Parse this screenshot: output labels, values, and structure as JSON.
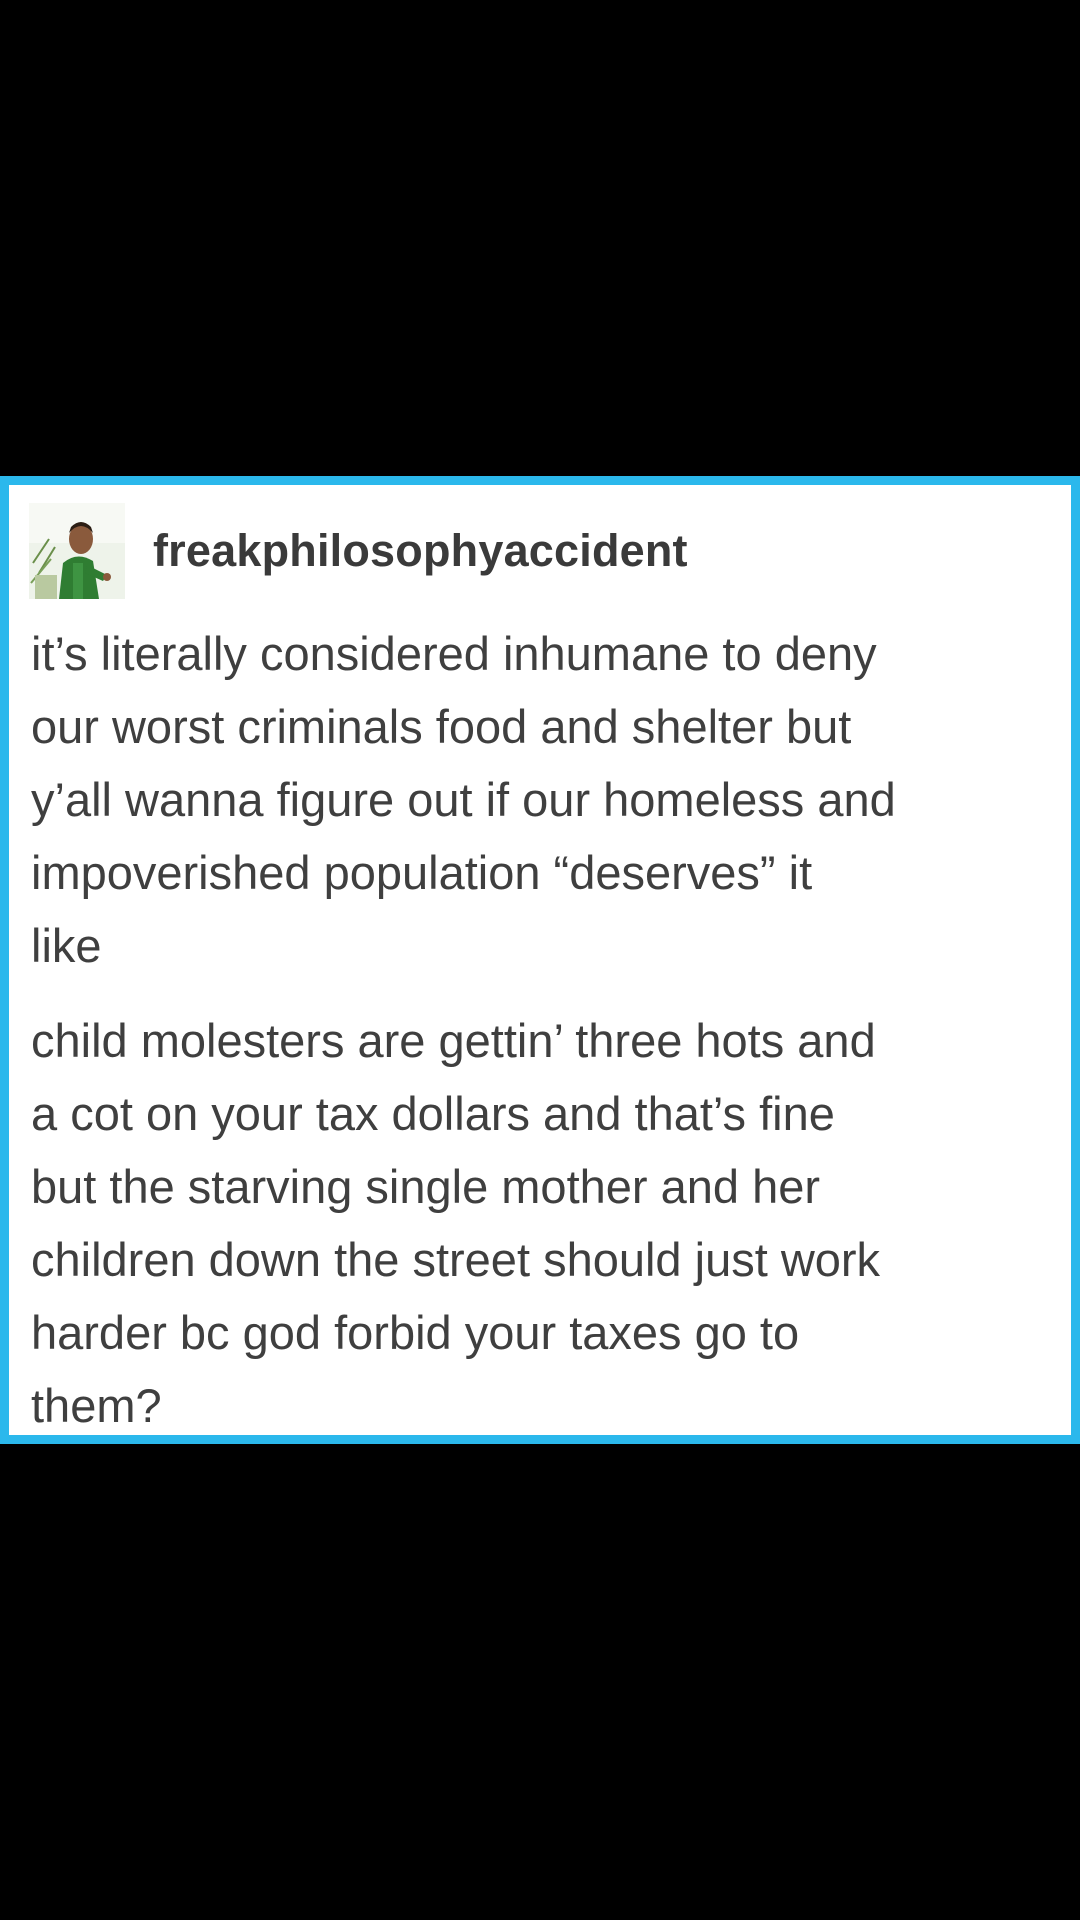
{
  "post": {
    "username": "freakphilosophyaccident",
    "avatar_icon": "user-avatar-photo",
    "paragraphs": [
      "it’s literally considered inhumane to deny\nour worst criminals food and shelter but\ny’all wanna figure out if our homeless and\nimpoverished population “deserves” it\nlike",
      "child molesters are gettin’ three hots and\na cot on your tax dollars and that’s fine\nbut the starving single mother and her\nchildren down the street should just work\nharder bc god forbid your taxes go to\nthem?"
    ]
  },
  "colors": {
    "background": "#000000",
    "card_border": "#2bb8ec",
    "card_background": "#ffffff",
    "text": "#3f3f3f"
  }
}
